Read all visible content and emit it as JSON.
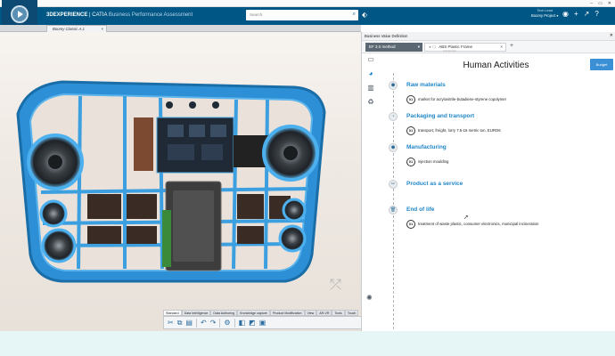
{
  "os": {
    "title": "3DEXPERIENCE",
    "controls": [
      "–",
      "▭",
      "✕"
    ]
  },
  "header": {
    "brand_3d": "3D",
    "brand_exp": "EXPERIENCE",
    "brand_app": " | CATIA ",
    "brand_sub": "Business Performance Assessment",
    "search_placeholder": "Search",
    "user_role": "Tech Lead",
    "user_name": "Boomy Project ▾"
  },
  "doc_tab": {
    "label": "Boomy  Classic A.1",
    "close": "×"
  },
  "viewport": {
    "gizmo": "⤱"
  },
  "actionbar": {
    "tabs": [
      {
        "label": "Standard",
        "active": true
      },
      {
        "label": "Data Intelligence",
        "active": false
      },
      {
        "label": "Data Authoring",
        "active": false
      },
      {
        "label": "Knowledge capture",
        "active": false
      },
      {
        "label": "Product Modification",
        "active": false
      },
      {
        "label": "View",
        "active": false
      },
      {
        "label": "AR-VR",
        "active": false
      },
      {
        "label": "Tools",
        "active": false
      },
      {
        "label": "Touch",
        "active": false
      }
    ]
  },
  "panel": {
    "title": "Business Value Definition",
    "selector": "EF 3.0 method",
    "tab_label": "ABS Plastic Frame",
    "tab_sub": "Component",
    "heading": "Human Activities",
    "budget_button": "Budget",
    "stages": [
      {
        "name": "Raw materials",
        "icon": "⬢",
        "item_badge": "01",
        "item_text": "market for acrylonitrile-butadiene-styrene copolymer"
      },
      {
        "name": "Packaging and transport",
        "icon": "◔",
        "item_badge": "01",
        "item_text": "transport, freight, lorry 7.5-16 metric ton, EURO6"
      },
      {
        "name": "Manufacturing",
        "icon": "⬢",
        "item_badge": "01",
        "item_text": "injection moulding"
      },
      {
        "name": "Product as a service",
        "icon": "✂",
        "item_badge": "",
        "item_text": ""
      },
      {
        "name": "End of life",
        "icon": "🗑",
        "item_badge": "01",
        "item_text": "treatment of waste plastic, consumer electronics, municipal incineration"
      }
    ]
  }
}
